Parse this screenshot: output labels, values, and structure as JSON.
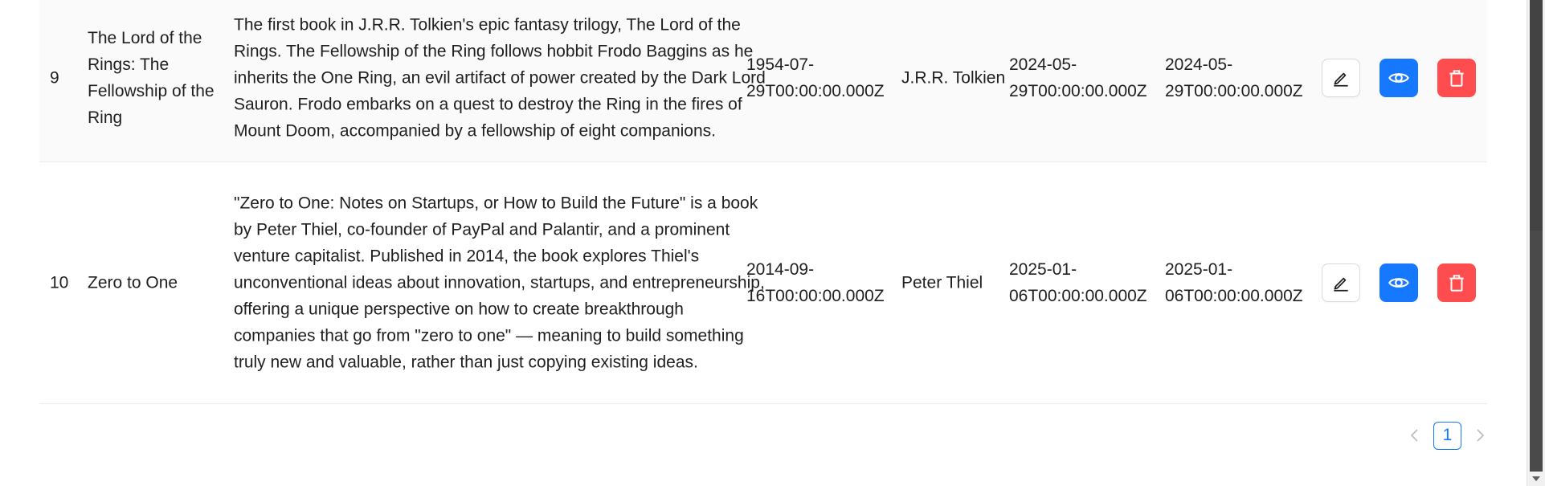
{
  "rows": [
    {
      "id": "9",
      "title": "The Lord of the Rings: The Fellowship of the Ring",
      "description": "The first book in J.R.R. Tolkien's epic fantasy trilogy, The Lord of the Rings. The Fellowship of the Ring follows hobbit Frodo Baggins as he inherits the One Ring, an evil artifact of power created by the Dark Lord Sauron. Frodo embarks on a quest to destroy the Ring in the fires of Mount Doom, accompanied by a fellowship of eight companions.",
      "published": "1954-07-29T00:00:00.000Z",
      "author": "J.R.R. Tolkien",
      "created": "2024-05-29T00:00:00.000Z",
      "updated": "2024-05-29T00:00:00.000Z"
    },
    {
      "id": "10",
      "title": "Zero to One",
      "description": "\"Zero to One: Notes on Startups, or How to Build the Future\" is a book by Peter Thiel, co-founder of PayPal and Palantir, and a prominent venture capitalist. Published in 2014, the book explores Thiel's unconventional ideas about innovation, startups, and entrepreneurship, offering a unique perspective on how to create breakthrough companies that go from \"zero to one\" — meaning to build something truly new and valuable, rather than just copying existing ideas.",
      "published": "2014-09-16T00:00:00.000Z",
      "author": "Peter Thiel",
      "created": "2025-01-06T00:00:00.000Z",
      "updated": "2025-01-06T00:00:00.000Z"
    }
  ],
  "icons": {
    "edit": "edit-icon",
    "view": "eye-icon",
    "delete": "trash-icon",
    "prev": "chevron-left-icon",
    "next": "chevron-right-icon"
  },
  "pagination": {
    "current_page": "1"
  },
  "colors": {
    "primary": "#1677ff",
    "danger": "#ff4d4f",
    "row_hover": "#fafafa"
  }
}
